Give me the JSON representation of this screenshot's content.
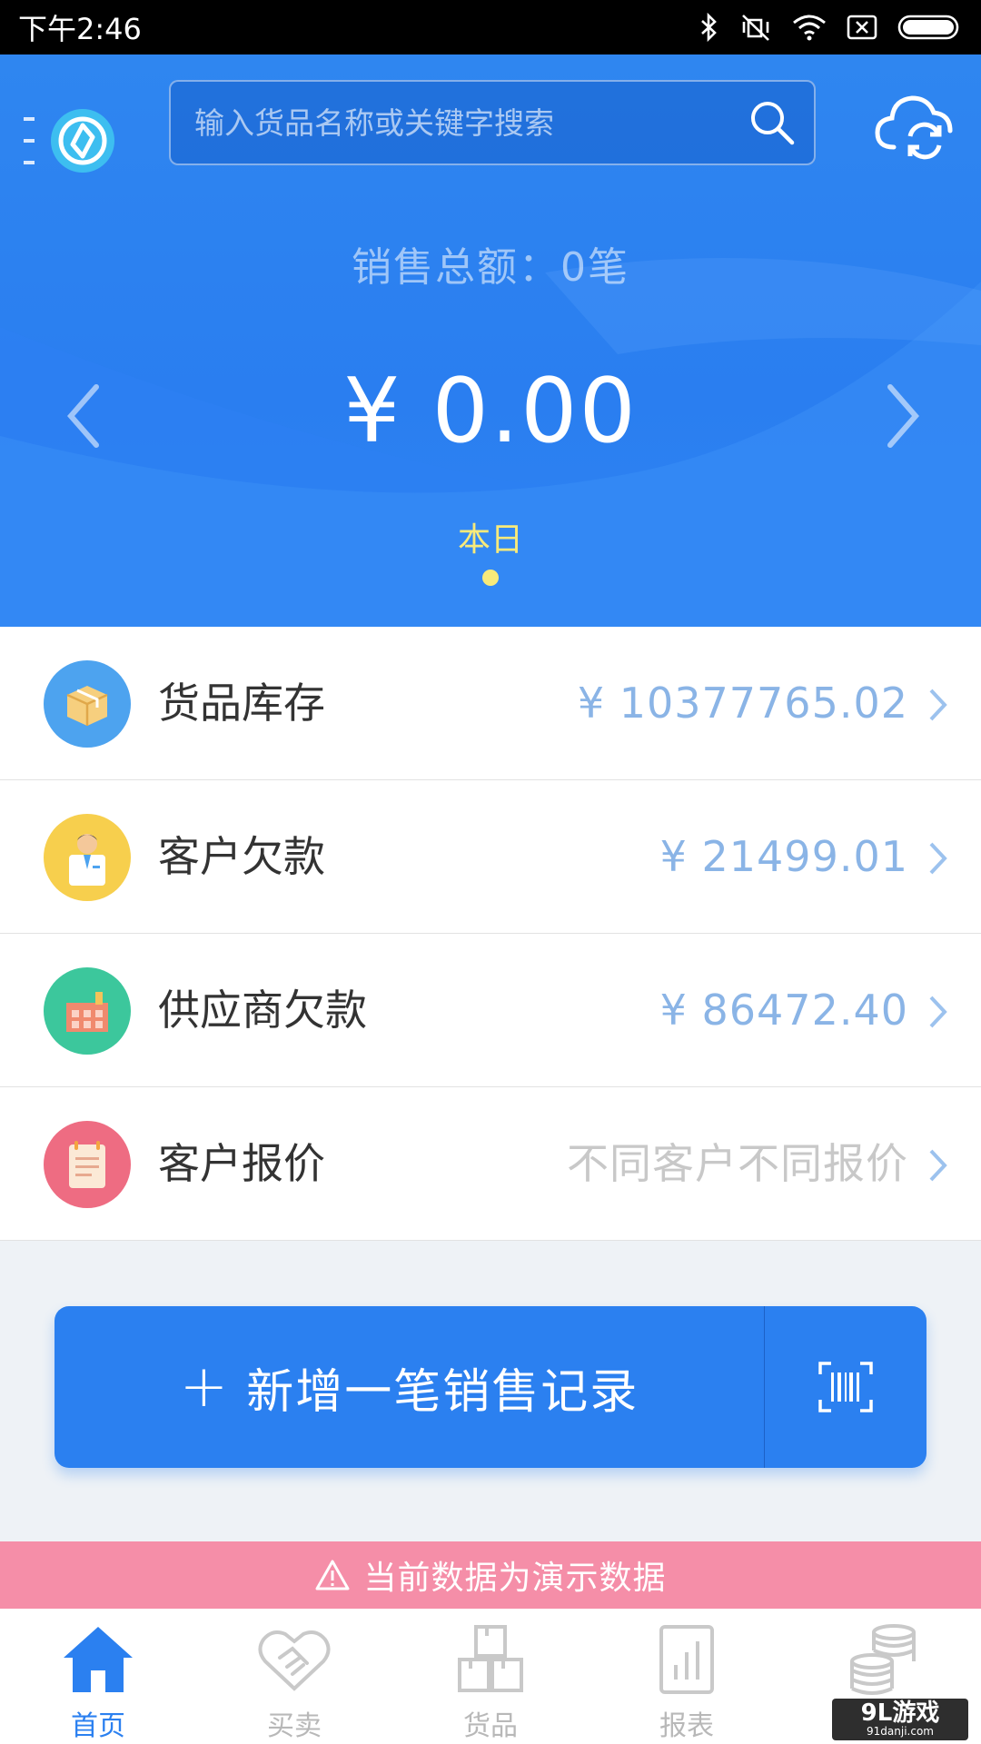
{
  "status_bar": {
    "time": "下午2:46"
  },
  "search": {
    "placeholder": "输入货品名称或关键字搜索"
  },
  "summary": {
    "label": "销售总额：0笔",
    "amount": "¥  0.00",
    "period": "本日"
  },
  "list": [
    {
      "label": "货品库存",
      "value": "¥  10377765.02",
      "icon": "box-icon",
      "color": "#4da3ef"
    },
    {
      "label": "客户欠款",
      "value": "¥  21499.01",
      "icon": "customer-icon",
      "color": "#f7cf4d"
    },
    {
      "label": "供应商欠款",
      "value": "¥  86472.40",
      "icon": "factory-icon",
      "color": "#3cc79c"
    },
    {
      "label": "客户报价",
      "value": "不同客户不同报价",
      "icon": "clipboard-icon",
      "color": "#ee6c82"
    }
  ],
  "add_button": {
    "plus": "+",
    "label": "新增一笔销售记录"
  },
  "demo_banner": {
    "text": "当前数据为演示数据"
  },
  "bottom_nav": [
    {
      "label": "首页",
      "icon": "home-icon",
      "active": true
    },
    {
      "label": "买卖",
      "icon": "handshake-icon",
      "active": false
    },
    {
      "label": "货品",
      "icon": "boxes-icon",
      "active": false
    },
    {
      "label": "报表",
      "icon": "bar-chart-icon",
      "active": false
    },
    {
      "label": "",
      "icon": "coins-icon",
      "active": false
    }
  ],
  "watermark": {
    "main": "9L游戏",
    "sub": "91danji.com"
  },
  "colors": {
    "primary": "#2b80f0",
    "accent_yellow": "#f8ea7a",
    "banner_pink": "#f58ea8"
  }
}
